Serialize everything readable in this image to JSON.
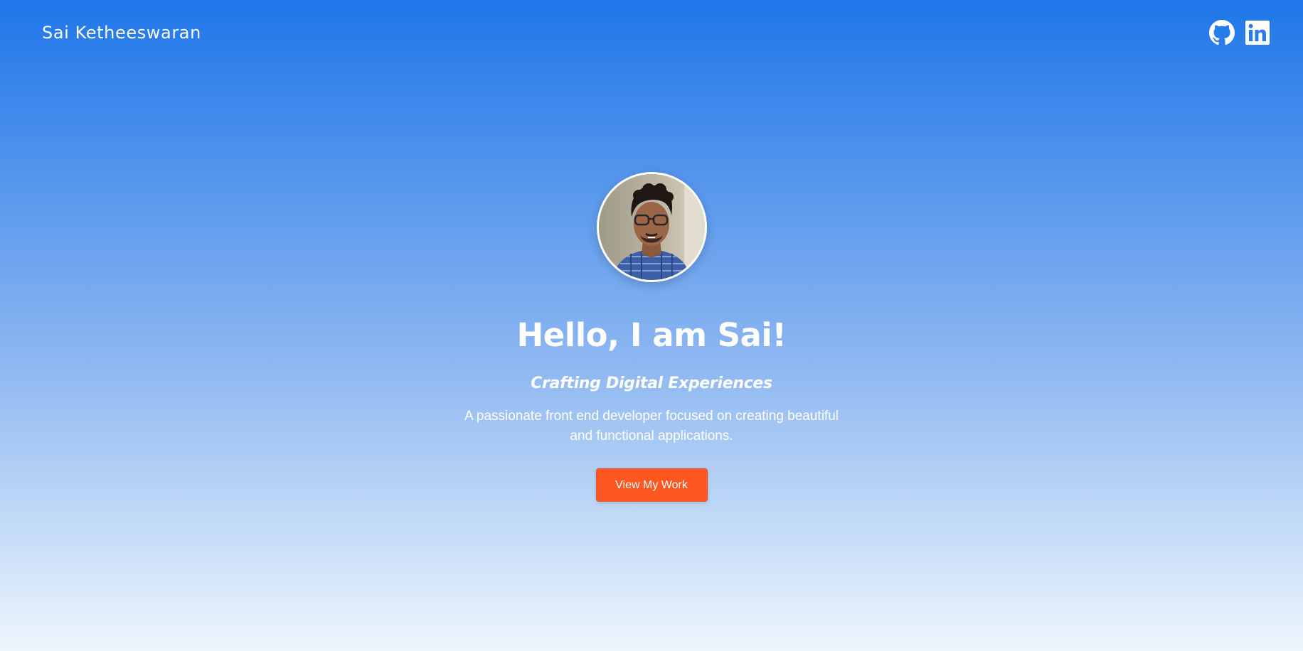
{
  "header": {
    "brand": "Sai Ketheeswaran",
    "social": [
      {
        "icon": "github-icon"
      },
      {
        "icon": "linkedin-icon",
        "text": "in"
      }
    ]
  },
  "hero": {
    "title": "Hello, I am Sai!",
    "subtitle": "Crafting Digital Experiences",
    "description": "A passionate front end developer focused on creating beautiful and functional applications.",
    "cta_label": "View My Work"
  },
  "colors": {
    "gradient_top": "#1f76e9",
    "gradient_bottom": "#eef5fc",
    "cta": "#ff5722",
    "text": "#ffffff"
  }
}
